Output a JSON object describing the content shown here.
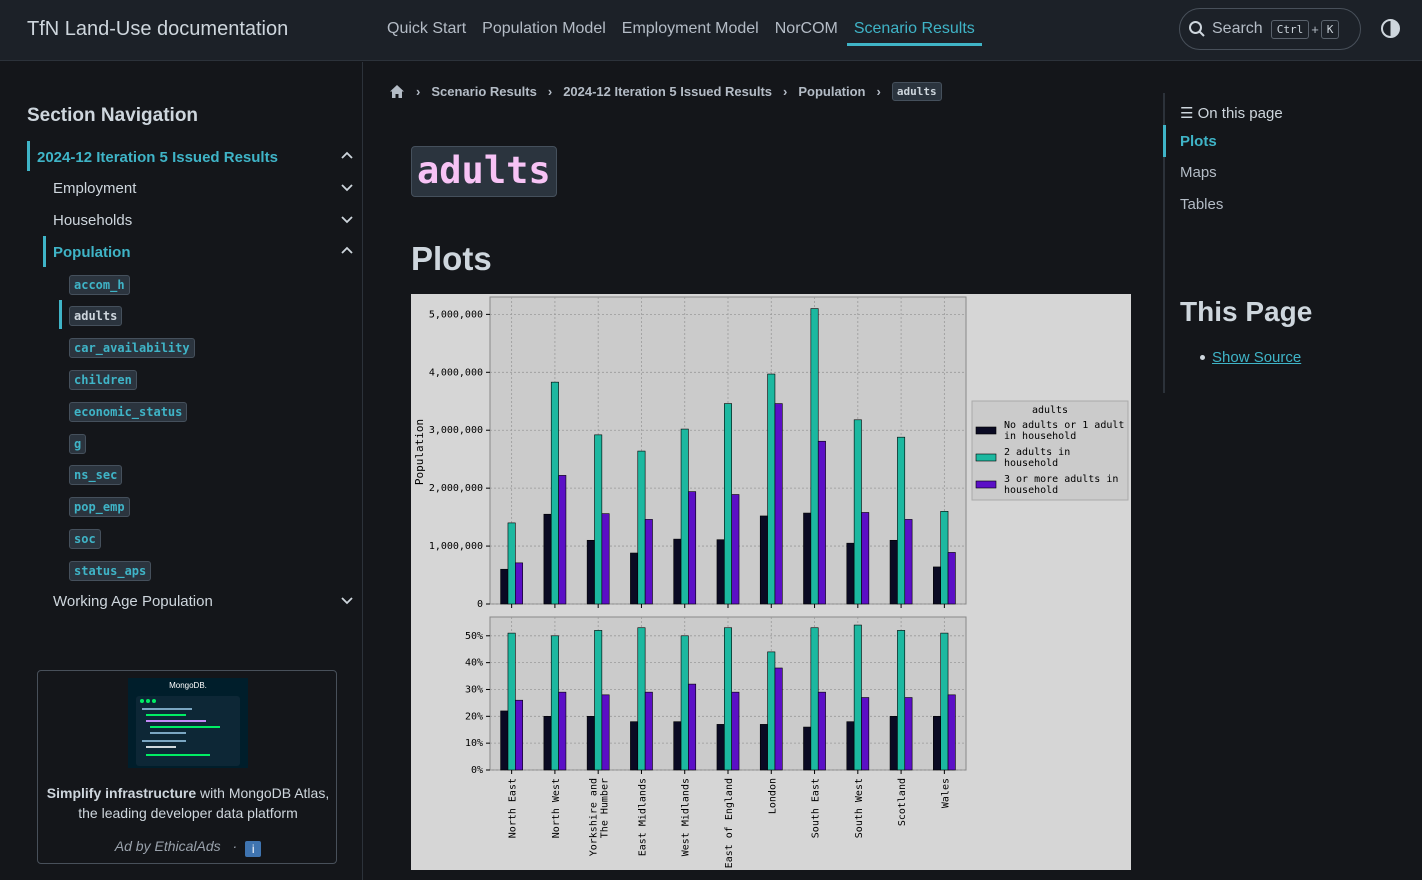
{
  "header": {
    "brand": "TfN Land-Use documentation",
    "nav": [
      "Quick Start",
      "Population Model",
      "Employment Model",
      "NorCOM",
      "Scenario Results"
    ],
    "active_nav": 4,
    "search_label": "Search",
    "kbd_ctrl": "Ctrl",
    "kbd_plus": "+",
    "kbd_k": "K"
  },
  "sidebar": {
    "heading": "Section Navigation",
    "top_item": "2024-12 Iteration 5 Issued Results",
    "items": [
      "Employment",
      "Households",
      "Population",
      "Working Age Population"
    ],
    "population_children": [
      "accom_h",
      "adults",
      "car_availability",
      "children",
      "economic_status",
      "g",
      "ns_sec",
      "pop_emp",
      "soc",
      "status_aps"
    ],
    "active_child": 1
  },
  "ad": {
    "bold": "Simplify infrastructure",
    "text": " with MongoDB Atlas, the leading developer data platform",
    "by": "Ad by EthicalAds",
    "sep": "·",
    "logo_text": "MongoDB."
  },
  "breadcrumb": [
    "Scenario Results",
    "2024-12 Iteration 5 Issued Results",
    "Population"
  ],
  "breadcrumb_current": "adults",
  "page": {
    "title": "adults",
    "section_heading": "Plots"
  },
  "toc": {
    "heading": "On this page",
    "items": [
      "Plots",
      "Maps",
      "Tables"
    ],
    "this_page": "This Page",
    "show_source": "Show Source"
  },
  "colors": {
    "accent": "#3fb4c7",
    "series1": "#0a0a23",
    "series2": "#1cb8a0",
    "series3": "#5b0fc6"
  },
  "chart_data": [
    {
      "type": "bar",
      "ylabel": "Population",
      "ylim": [
        0,
        5300000
      ],
      "yticks": [
        "0",
        "1,000,000",
        "2,000,000",
        "3,000,000",
        "4,000,000",
        "5,000,000"
      ],
      "ytick_values": [
        0,
        1000000,
        2000000,
        3000000,
        4000000,
        5000000
      ],
      "grid": true,
      "legend_title": "adults",
      "legend_placement": "right-outside",
      "categories": [
        "North East",
        "North West",
        "Yorkshire and The Humber",
        "East Midlands",
        "West Midlands",
        "East of England",
        "London",
        "South East",
        "South West",
        "Scotland",
        "Wales"
      ],
      "series": [
        {
          "name": "No adults or 1 adult in household",
          "values": [
            600000,
            1550000,
            1100000,
            880000,
            1120000,
            1110000,
            1520000,
            1570000,
            1050000,
            1100000,
            640000
          ]
        },
        {
          "name": "2 adults in household",
          "values": [
            1400000,
            3830000,
            2920000,
            2640000,
            3020000,
            3460000,
            3970000,
            5100000,
            3180000,
            2880000,
            1600000
          ]
        },
        {
          "name": "3 or more adults in household",
          "values": [
            710000,
            2220000,
            1560000,
            1460000,
            1940000,
            1890000,
            3460000,
            2810000,
            1580000,
            1460000,
            890000
          ]
        }
      ]
    },
    {
      "type": "bar",
      "ylim": [
        0,
        0.57
      ],
      "yticks": [
        "0%",
        "10%",
        "20%",
        "30%",
        "40%",
        "50%"
      ],
      "ytick_values": [
        0,
        0.1,
        0.2,
        0.3,
        0.4,
        0.5
      ],
      "grid": true,
      "categories": [
        "North East",
        "North West",
        "Yorkshire and The Humber",
        "East Midlands",
        "West Midlands",
        "East of England",
        "London",
        "South East",
        "South West",
        "Scotland",
        "Wales"
      ],
      "category_labels": [
        [
          "North East"
        ],
        [
          "North West"
        ],
        [
          "Yorkshire and",
          "The Humber"
        ],
        [
          "East Midlands"
        ],
        [
          "West Midlands"
        ],
        [
          "East of England"
        ],
        [
          "London"
        ],
        [
          "South East"
        ],
        [
          "South West"
        ],
        [
          "Scotland"
        ],
        [
          "Wales"
        ]
      ],
      "series": [
        {
          "name": "No adults or 1 adult in household",
          "values": [
            0.22,
            0.2,
            0.2,
            0.18,
            0.18,
            0.17,
            0.17,
            0.16,
            0.18,
            0.2,
            0.2
          ]
        },
        {
          "name": "2 adults in household",
          "values": [
            0.51,
            0.5,
            0.52,
            0.53,
            0.5,
            0.53,
            0.44,
            0.53,
            0.54,
            0.52,
            0.51
          ]
        },
        {
          "name": "3 or more adults in household",
          "values": [
            0.26,
            0.29,
            0.28,
            0.29,
            0.32,
            0.29,
            0.38,
            0.29,
            0.27,
            0.27,
            0.28
          ]
        }
      ]
    }
  ]
}
